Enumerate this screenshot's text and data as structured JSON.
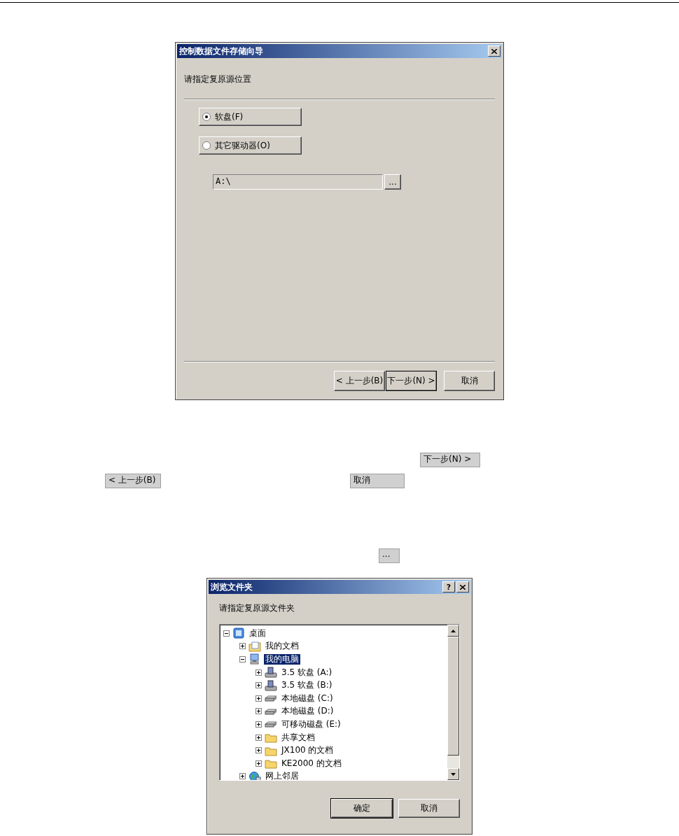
{
  "wizard": {
    "title": "控制数据文件存储向导",
    "prompt": "请指定复原源位置",
    "sources": [
      {
        "label": "软盘(F)",
        "selected": true
      },
      {
        "label": "其它驱动器(O)",
        "selected": false
      }
    ],
    "path": {
      "value": "A:\\"
    },
    "browse_button": "...",
    "buttons": [
      {
        "label": "< 上一步(B)",
        "default": false
      },
      {
        "label": "下一步(N) >",
        "default": true
      },
      {
        "label": "取消",
        "default": false
      }
    ]
  },
  "figure_buttons": [
    {
      "buttons": [
        "下一步(N) >"
      ]
    },
    {
      "buttons": [
        "< 上一步(B)",
        "取消"
      ]
    },
    {
      "buttons": [
        "..."
      ]
    }
  ],
  "folder_dialog": {
    "title": "浏览文件夹",
    "help": "?",
    "prompt": "请指定复原源文件夹",
    "tree": [
      {
        "label": "桌面",
        "kind": "desktop",
        "expanded": true,
        "selected": false,
        "children": [
          {
            "label": "我的文档",
            "kind": "documents",
            "expanded": false,
            "selected": false
          },
          {
            "label": "我的电脑",
            "kind": "computer",
            "expanded": true,
            "selected": true,
            "children": [
              {
                "label": "3.5 软盘 (A:)",
                "kind": "floppy",
                "expanded": false,
                "selected": false
              },
              {
                "label": "3.5 软盘 (B:)",
                "kind": "floppy",
                "expanded": false,
                "selected": false
              },
              {
                "label": "本地磁盘 (C:)",
                "kind": "disk",
                "expanded": false,
                "selected": false
              },
              {
                "label": "本地磁盘 (D:)",
                "kind": "disk",
                "expanded": false,
                "selected": false
              },
              {
                "label": "可移动磁盘 (E:)",
                "kind": "disk",
                "expanded": false,
                "selected": false
              },
              {
                "label": "共享文档",
                "kind": "folder",
                "expanded": false,
                "selected": false
              },
              {
                "label": "JX100 的文档",
                "kind": "folder",
                "expanded": false,
                "selected": false
              },
              {
                "label": "KE2000 的文档",
                "kind": "folder",
                "expanded": false,
                "selected": false
              }
            ]
          },
          {
            "label": "网上邻居",
            "kind": "network",
            "expanded": false,
            "selected": false
          }
        ]
      }
    ],
    "buttons": [
      {
        "label": "确定",
        "default": true
      },
      {
        "label": "取消",
        "default": false
      }
    ]
  }
}
